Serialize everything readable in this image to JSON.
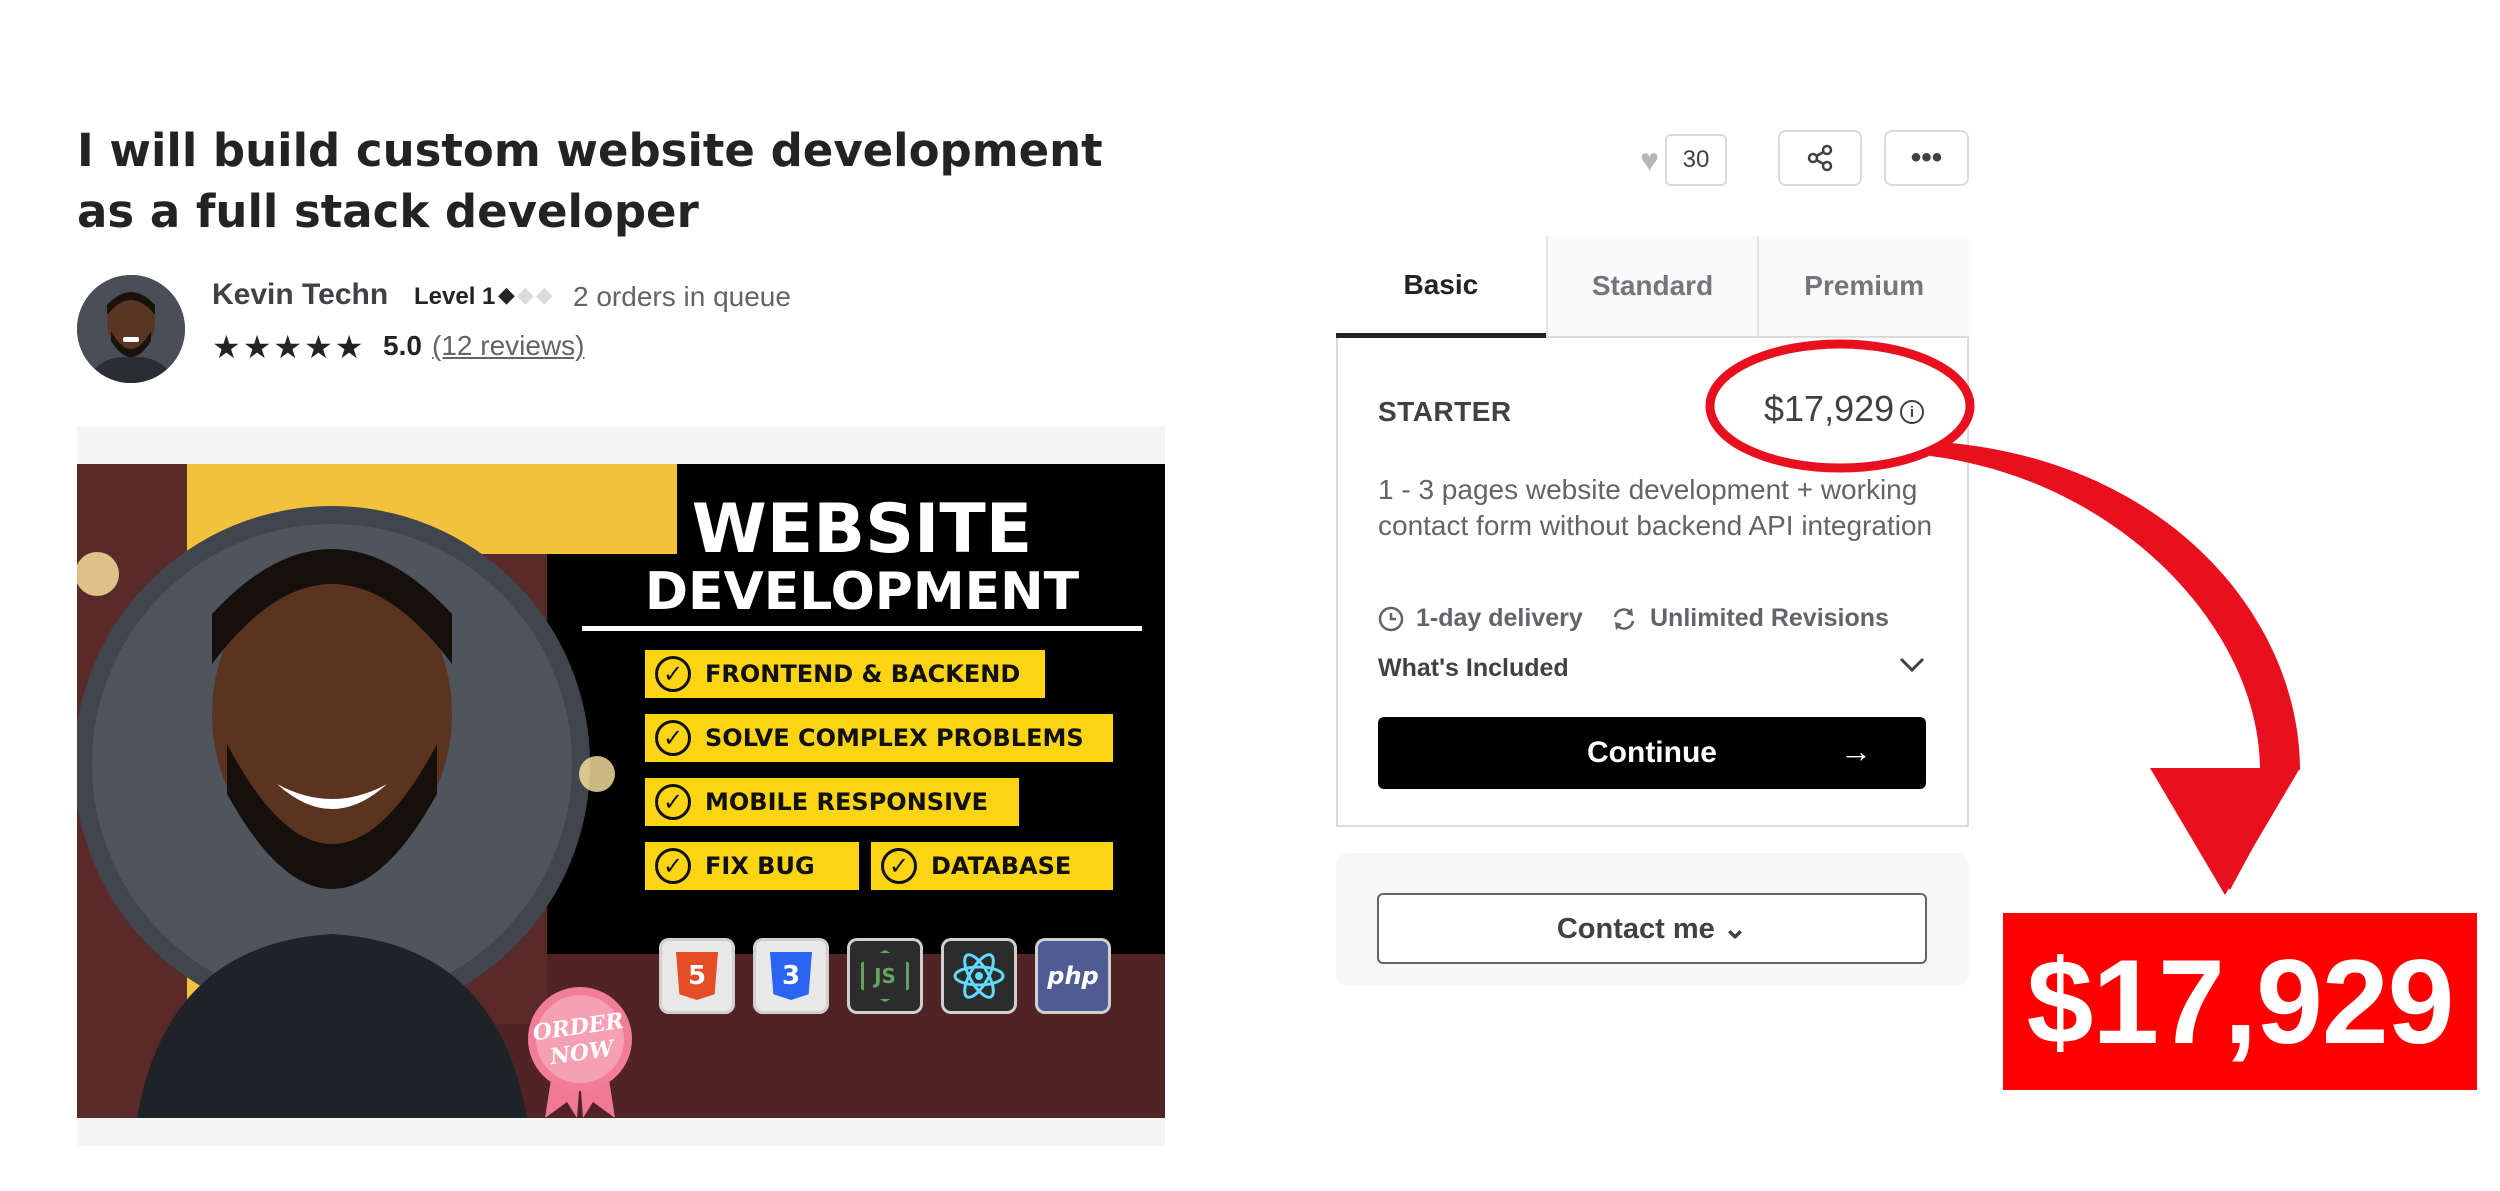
{
  "gig": {
    "title": "I will build custom website development as a full stack developer"
  },
  "seller": {
    "name": "Kevin Techn",
    "level": "Level 1",
    "queue": "2 orders in queue",
    "rating": "5.0",
    "reviews": "(12 reviews)"
  },
  "gallery_image": {
    "headline_1": "WEBSITE",
    "headline_2": "DEVELOPMENT",
    "features": [
      "FRONTEND & BACKEND",
      "SOLVE COMPLEX PROBLEMS",
      "MOBILE RESPONSIVE",
      "FIX BUG",
      "DATABASE"
    ],
    "badge_1": "ORDER",
    "badge_2": "NOW",
    "tech_icons": [
      "html5-icon",
      "css3-icon",
      "nodejs-icon",
      "react-icon",
      "php-icon"
    ],
    "tech_labels": {
      "html": "5",
      "css": "3",
      "js": "JS",
      "php": "php"
    }
  },
  "actions": {
    "like_count": "30",
    "more_label": "•••"
  },
  "package": {
    "tabs": [
      "Basic",
      "Standard",
      "Premium"
    ],
    "active_tab": "Basic",
    "name": "STARTER",
    "price": "$17,929",
    "info_label": "i",
    "description": "1 - 3 pages website development + working contact form without backend API integration",
    "delivery": "1-day delivery",
    "revisions": "Unlimited Revisions",
    "included_label": "What's Included",
    "continue_label": "Continue",
    "continue_arrow": "→"
  },
  "contact": {
    "label": "Contact me ⌄"
  },
  "annotation": {
    "price_callout": "$17,929",
    "highlight_color": "#e8101f",
    "callout_bg": "#fe0000"
  },
  "icons": {
    "heart": "♥",
    "star": "★",
    "check": "✓",
    "chevron_down": "⌄"
  }
}
